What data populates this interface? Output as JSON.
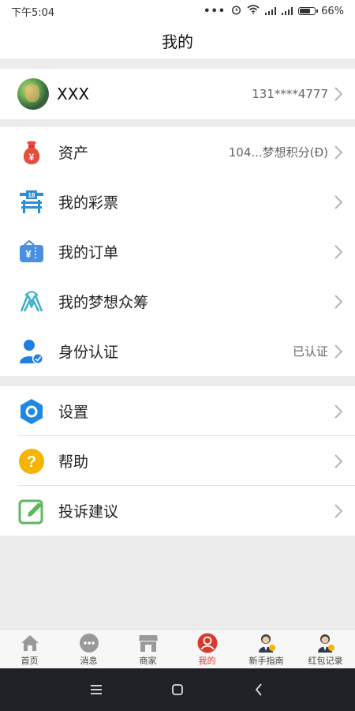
{
  "status_bar": {
    "time": "下午5:04",
    "battery": "66%"
  },
  "header": {
    "title": "我的"
  },
  "profile": {
    "name": "XXX",
    "phone": "131****4777"
  },
  "menu_group_1": [
    {
      "label": "资产",
      "value": "104...梦想积分(Đ)",
      "icon": "money-bag-icon"
    },
    {
      "label": "我的彩票",
      "value": "",
      "icon": "lottery-ticket-icon"
    },
    {
      "label": "我的订单",
      "value": "",
      "icon": "order-ticket-icon"
    },
    {
      "label": "我的梦想众筹",
      "value": "",
      "icon": "dream-crowdfunding-icon"
    },
    {
      "label": "身份认证",
      "value": "已认证",
      "icon": "identity-verified-icon"
    }
  ],
  "menu_group_2": [
    {
      "label": "设置",
      "icon": "settings-icon"
    },
    {
      "label": "帮助",
      "icon": "help-icon"
    },
    {
      "label": "投诉建议",
      "icon": "feedback-icon"
    }
  ],
  "tabbar": [
    {
      "label": "首页",
      "icon": "home-icon",
      "active": false
    },
    {
      "label": "消息",
      "icon": "message-icon",
      "active": false
    },
    {
      "label": "商家",
      "icon": "store-icon",
      "active": false
    },
    {
      "label": "我的",
      "icon": "profile-icon",
      "active": true
    },
    {
      "label": "新手指南",
      "icon": "guide-icon",
      "active": false
    },
    {
      "label": "红包记录",
      "icon": "red-packet-record-icon",
      "active": false
    }
  ],
  "colors": {
    "active_tab": "#d93a2a",
    "money_bag": "#e94b3c",
    "lottery_blue": "#2b8fd6",
    "settings_blue": "#1e88e5",
    "help_yellow": "#f5b400",
    "feedback_green": "#5cb85c"
  }
}
